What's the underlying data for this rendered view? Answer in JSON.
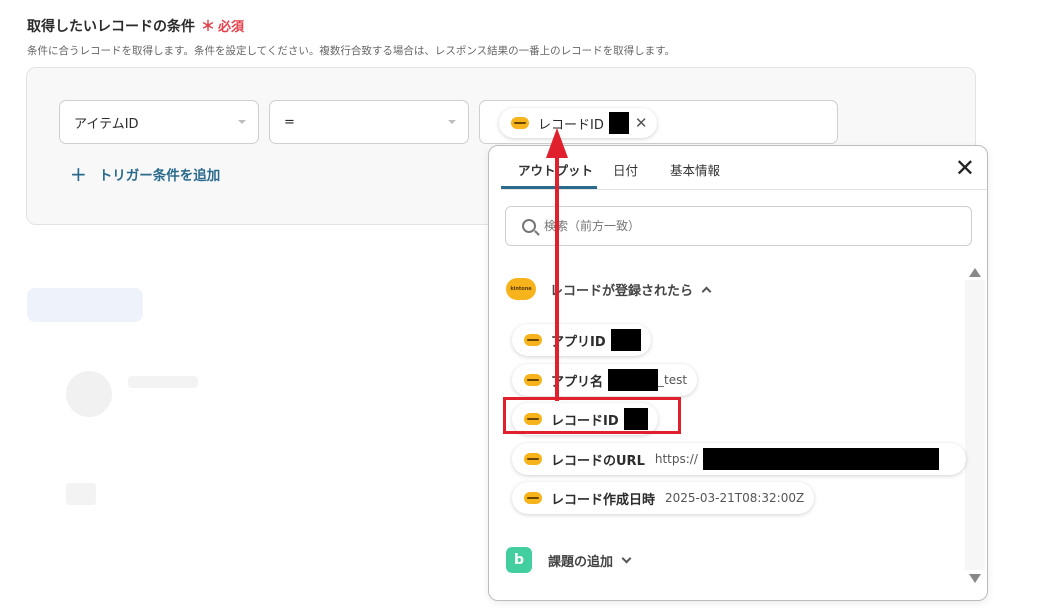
{
  "section": {
    "title": "取得したいレコードの条件",
    "required_mark": "＊",
    "required_text": "必須",
    "description": "条件に合うレコードを取得します。条件を設定してください。複数行合致する場合は、レスポンス結果の一番上のレコードを取得します。"
  },
  "condition": {
    "field": "アイテムID",
    "operator": "=",
    "value_chip": "レコードID",
    "add_trigger": "トリガー条件を追加"
  },
  "popup": {
    "tabs": [
      "アウトプット",
      "日付",
      "基本情報"
    ],
    "search_placeholder": "検索（前方一致）",
    "group1": {
      "logo_text": "kintone",
      "label": "レコードが登録されたら",
      "items": [
        {
          "label": "アプリID",
          "value": ""
        },
        {
          "label": "アプリ名",
          "value": "_test"
        },
        {
          "label": "レコードID",
          "value": ""
        },
        {
          "label": "レコードのURL",
          "value": "https://"
        },
        {
          "label": "レコード作成日時",
          "value": "2025-03-21T08:32:00Z"
        }
      ]
    },
    "group2": {
      "logo_text": "b",
      "label": "課題の追加"
    }
  },
  "colors": {
    "accent": "#2a6a8c",
    "required": "#e5404b",
    "highlight": "#e0202c",
    "kintone": "#f6b31c",
    "backlog": "#42ce9f"
  }
}
